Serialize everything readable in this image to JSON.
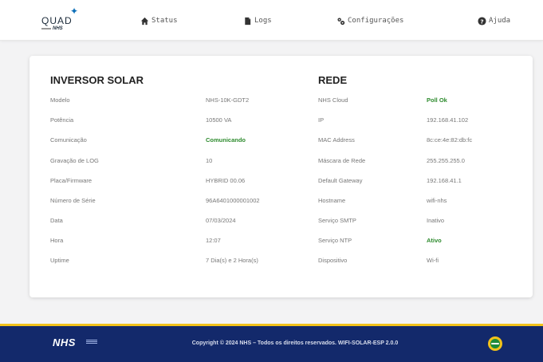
{
  "nav": {
    "items": [
      {
        "label": "Status",
        "icon": "home-icon"
      },
      {
        "label": "Logs",
        "icon": "file-icon"
      },
      {
        "label": "Configurações",
        "icon": "gears-icon"
      },
      {
        "label": "Ajuda",
        "icon": "question-icon"
      }
    ]
  },
  "logo": {
    "text": "QUAD",
    "sub": "NHS"
  },
  "inversor": {
    "title": "INVERSOR SOLAR",
    "rows": [
      {
        "label": "Modelo",
        "value": "NHS-10K-GDT2"
      },
      {
        "label": "Potência",
        "value": "10500 VA"
      },
      {
        "label": "Comunicação",
        "value": "Comunicando"
      },
      {
        "label": "Gravação de LOG",
        "value": "10"
      },
      {
        "label": "Placa/Firmware",
        "value": "HYBRID 00.06"
      },
      {
        "label": "Número de Série",
        "value": "96A6401000001002"
      },
      {
        "label": "Data",
        "value": "07/03/2024"
      },
      {
        "label": "Hora",
        "value": "12:07"
      },
      {
        "label": "Uptime",
        "value": "7 Dia(s) e 2 Hora(s)"
      }
    ]
  },
  "rede": {
    "title": "REDE",
    "rows": [
      {
        "label": "NHS Cloud",
        "value": "Poll Ok"
      },
      {
        "label": "IP",
        "value": "192.168.41.102"
      },
      {
        "label": "MAC Address",
        "value": "8c:ce:4e:82:db:fc"
      },
      {
        "label": "Máscara de Rede",
        "value": "255.255.255.0"
      },
      {
        "label": "Default Gateway",
        "value": "192.168.41.1"
      },
      {
        "label": "Hostname",
        "value": "wifi-nhs"
      },
      {
        "label": "Serviço SMTP",
        "value": "Inativo"
      },
      {
        "label": "Serviço NTP",
        "value": "Ativo"
      },
      {
        "label": "Dispositivo",
        "value": "Wi-fi"
      }
    ]
  },
  "footer": {
    "logo": "NHS",
    "copyright": "Copyright © 2024 NHS – Todos os direitos reservados. WIFI-SOLAR-ESP 2.0.0"
  },
  "colors": {
    "status_green": "#2e8b2e",
    "footer_bg": "#13296b",
    "footer_accent": "#f2c21a"
  }
}
